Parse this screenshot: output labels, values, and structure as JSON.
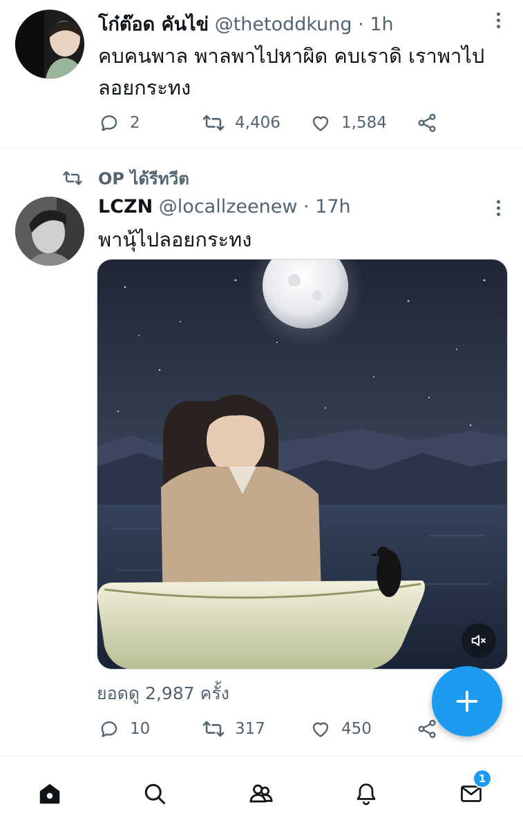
{
  "tweet1": {
    "display_name": "โก๋ต๊อด คันไข่",
    "handle": "@thetoddkung",
    "separator": "·",
    "time": "1h",
    "text": "คบคนพาล พาลพาไปหาผิด คบเราดิ เราพาไปลอยกระทง",
    "replies": "2",
    "retweets": "4,406",
    "likes": "1,584"
  },
  "retweet_label": "OP ได้รีทวีต",
  "tweet2": {
    "display_name": "LCZN",
    "handle": "@locallzeenew",
    "separator": "·",
    "time": "17h",
    "text": "พานุ้ไปลอยกระทง",
    "views": "ยอดดู 2,987 ครั้ง",
    "replies": "10",
    "retweets": "317",
    "likes": "450"
  },
  "bottom_nav": {
    "messages_badge": "1"
  },
  "colors": {
    "accent": "#1d9bf0",
    "muted": "#536471",
    "text": "#0f1419"
  }
}
